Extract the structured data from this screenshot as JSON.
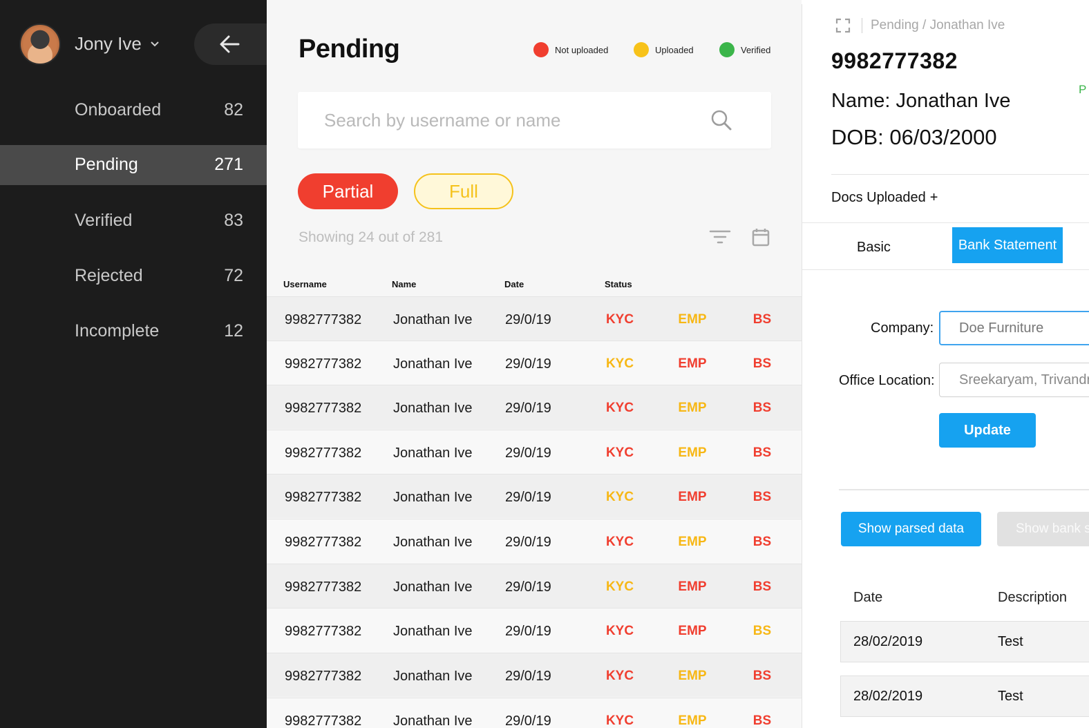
{
  "sidebar": {
    "user_name": "Jony Ive",
    "items": [
      {
        "label": "Onboarded",
        "count": "82"
      },
      {
        "label": "Pending",
        "count": "271"
      },
      {
        "label": "Verified",
        "count": "83"
      },
      {
        "label": "Rejected",
        "count": "72"
      },
      {
        "label": "Incomplete",
        "count": "12"
      }
    ]
  },
  "main": {
    "title": "Pending",
    "legend": [
      {
        "label": "Not uploaded",
        "color": "#f03e2f"
      },
      {
        "label": "Uploaded",
        "color": "#f7c21a"
      },
      {
        "label": "Verified",
        "color": "#3bb54a"
      }
    ],
    "search": {
      "placeholder": "Search by username or name",
      "value": ""
    },
    "filters": {
      "partial": "Partial",
      "full": "Full"
    },
    "showing": "Showing 24 out of 281",
    "columns": {
      "username": "Username",
      "name": "Name",
      "date": "Date",
      "status": "Status"
    },
    "rows": [
      {
        "username": "9982777382",
        "name": "Jonathan Ive",
        "date": "29/0/19",
        "kyc": "KYC",
        "emp": "EMP",
        "bs": "BS",
        "kyc_state": "red",
        "emp_state": "yellow",
        "bs_state": "red"
      },
      {
        "username": "9982777382",
        "name": "Jonathan Ive",
        "date": "29/0/19",
        "kyc": "KYC",
        "emp": "EMP",
        "bs": "BS",
        "kyc_state": "yellow",
        "emp_state": "red",
        "bs_state": "red"
      },
      {
        "username": "9982777382",
        "name": "Jonathan Ive",
        "date": "29/0/19",
        "kyc": "KYC",
        "emp": "EMP",
        "bs": "BS",
        "kyc_state": "red",
        "emp_state": "yellow",
        "bs_state": "red"
      },
      {
        "username": "9982777382",
        "name": "Jonathan Ive",
        "date": "29/0/19",
        "kyc": "KYC",
        "emp": "EMP",
        "bs": "BS",
        "kyc_state": "red",
        "emp_state": "yellow",
        "bs_state": "red"
      },
      {
        "username": "9982777382",
        "name": "Jonathan Ive",
        "date": "29/0/19",
        "kyc": "KYC",
        "emp": "EMP",
        "bs": "BS",
        "kyc_state": "yellow",
        "emp_state": "red",
        "bs_state": "red"
      },
      {
        "username": "9982777382",
        "name": "Jonathan Ive",
        "date": "29/0/19",
        "kyc": "KYC",
        "emp": "EMP",
        "bs": "BS",
        "kyc_state": "red",
        "emp_state": "yellow",
        "bs_state": "red"
      },
      {
        "username": "9982777382",
        "name": "Jonathan Ive",
        "date": "29/0/19",
        "kyc": "KYC",
        "emp": "EMP",
        "bs": "BS",
        "kyc_state": "yellow",
        "emp_state": "red",
        "bs_state": "red"
      },
      {
        "username": "9982777382",
        "name": "Jonathan Ive",
        "date": "29/0/19",
        "kyc": "KYC",
        "emp": "EMP",
        "bs": "BS",
        "kyc_state": "red",
        "emp_state": "red",
        "bs_state": "yellow"
      },
      {
        "username": "9982777382",
        "name": "Jonathan Ive",
        "date": "29/0/19",
        "kyc": "KYC",
        "emp": "EMP",
        "bs": "BS",
        "kyc_state": "red",
        "emp_state": "yellow",
        "bs_state": "red"
      },
      {
        "username": "9982777382",
        "name": "Jonathan Ive",
        "date": "29/0/19",
        "kyc": "KYC",
        "emp": "EMP",
        "bs": "BS",
        "kyc_state": "red",
        "emp_state": "yellow",
        "bs_state": "red"
      }
    ]
  },
  "detail": {
    "breadcrumb": "Pending / Jonathan Ive",
    "phone": "9982777382",
    "name": "Name: Jonathan Ive",
    "dob": "DOB: 06/03/2000",
    "edge_mark": "P",
    "docs_uploaded": "Docs Uploaded",
    "docs_plus": "+",
    "tabs": {
      "basic": "Basic",
      "bank": "Bank Statement"
    },
    "company_label": "Company:",
    "company_value": "Doe Furniture",
    "office_label": "Office Location:",
    "office_value": "Sreekaryam, Trivandrum",
    "update": "Update",
    "show_parsed": "Show parsed data",
    "show_bank": "Show bank statement",
    "tx_columns": {
      "date": "Date",
      "description": "Description"
    },
    "transactions": [
      {
        "date": "28/02/2019",
        "description": "Test"
      },
      {
        "date": "28/02/2019",
        "description": "Test"
      }
    ]
  },
  "colors": {
    "red": "#f03e2f",
    "yellow": "#f7b715",
    "green": "#3bb54a",
    "accent_blue": "#16a2f0",
    "sidebar_bg": "#1c1c1c"
  }
}
